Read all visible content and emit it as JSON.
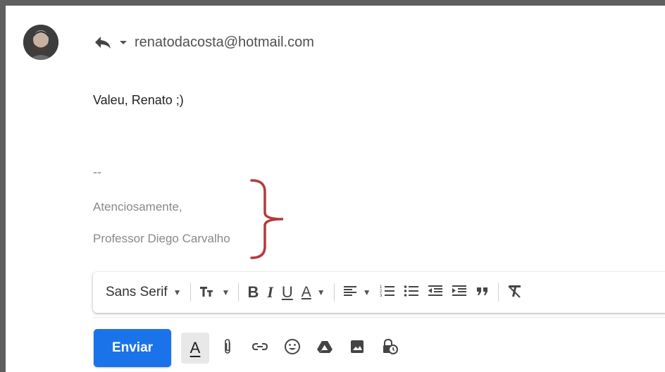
{
  "header": {
    "recipient": "renatodacosta@hotmail.com",
    "icons": [
      "avatar",
      "reply-icon",
      "chevron-down-icon"
    ]
  },
  "message": {
    "body": "Valeu, Renato ;)",
    "signature_separator": "--",
    "signature_line1": "Atenciosamente,",
    "signature_line2": "Professor Diego Carvalho"
  },
  "format_bar": {
    "font": "Sans Serif",
    "bold_label": "B",
    "italic_label": "I",
    "underline_label": "U",
    "text_color_label": "A",
    "icons": [
      "text-size-icon",
      "align-icon",
      "numbered-list-icon",
      "bulleted-list-icon",
      "indent-less-icon",
      "indent-more-icon",
      "quote-icon",
      "remove-formatting-icon"
    ]
  },
  "actions": {
    "send_label": "Enviar",
    "formatting_label": "A",
    "icons": [
      "attach-icon",
      "link-icon",
      "emoji-icon",
      "drive-icon",
      "photo-icon",
      "confidential-icon"
    ]
  },
  "colors": {
    "send_button": "#1a73e8",
    "brace": "#b53a3a",
    "signature_text": "#888888",
    "window_border": "#5f5f5f"
  }
}
